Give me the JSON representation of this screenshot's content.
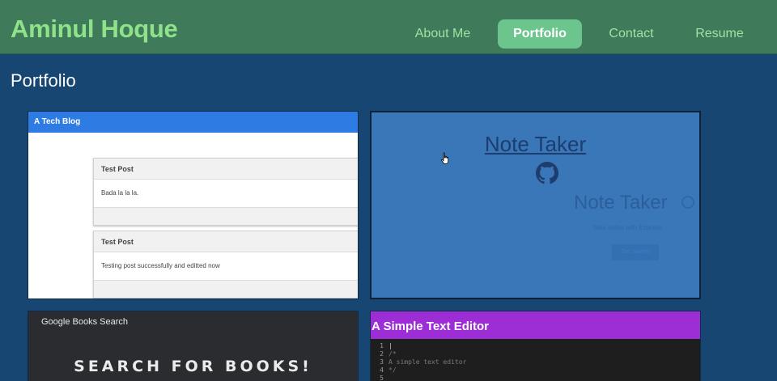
{
  "header": {
    "brand": "Aminul Hoque",
    "nav": [
      {
        "label": "About Me",
        "active": false
      },
      {
        "label": "Portfolio",
        "active": true
      },
      {
        "label": "Contact",
        "active": false
      },
      {
        "label": "Resume",
        "active": false
      }
    ]
  },
  "page": {
    "title": "Portfolio"
  },
  "projects": [
    {
      "title": "A Tech Blog",
      "posts": [
        {
          "title": "Test Post",
          "body": "Bada la la la."
        },
        {
          "title": "Test Post",
          "body": "Testing post successfully and editted now"
        }
      ]
    },
    {
      "title": "Note Taker",
      "hover_link": "Note Taker",
      "preview_title": "Note Taker",
      "preview_subtitle": "Take notes with Express",
      "preview_button": "Get Started",
      "icon": "github-icon"
    },
    {
      "title": "Google Books Search",
      "headline": "SEARCH FOR BOOKS!"
    },
    {
      "title": "A Simple Text Editor",
      "code_lines": [
        {
          "num": "1",
          "text": "|"
        },
        {
          "num": "2",
          "text": "/*"
        },
        {
          "num": "3",
          "text": "A simple text editor"
        },
        {
          "num": "4",
          "text": "*/"
        },
        {
          "num": "5",
          "text": ""
        }
      ]
    }
  ],
  "colors": {
    "background": "#174672",
    "header": "#3f7a5a",
    "brand_text": "#8fe28a",
    "nav_active_bg": "#6cc58d",
    "tech_blog_bar": "#2f7be4",
    "editor_bar": "#9d2ed6"
  }
}
